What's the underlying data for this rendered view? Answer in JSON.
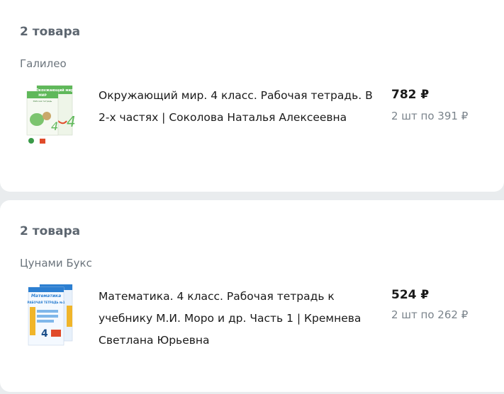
{
  "orders": [
    {
      "count_label": "2 товара",
      "seller": "Галилео",
      "item": {
        "title": "Окружающий мир. 4 класс. Рабочая тетрадь. В 2-х частях | Соколова Наталья Алексеевна",
        "price": "782 ₽",
        "unit_price": "2 шт по 391 ₽",
        "cover": {
          "header_text": "Окружающий мир",
          "sub_text": "Рабочая тетрадь",
          "grade": "4",
          "colors": {
            "green": "#5fb85a",
            "bg": "#eef5e8",
            "accent": "#e04b2a"
          }
        }
      }
    },
    {
      "count_label": "2 товара",
      "seller": "Цунами Букс",
      "item": {
        "title": "Математика. 4 класс. Рабочая тетрадь к учебнику М.И. Моро и др. Часть 1 | Кремнева Светлана Юрьевна",
        "price": "524 ₽",
        "unit_price": "2 шт по 262 ₽",
        "cover": {
          "header_text": "Математика",
          "sub_text": "РАБОЧАЯ ТЕТРАДЬ №1",
          "grade": "4",
          "colors": {
            "blue": "#2c7fd1",
            "bg": "#e8f1fb",
            "accent": "#f0b52a"
          }
        }
      }
    }
  ]
}
